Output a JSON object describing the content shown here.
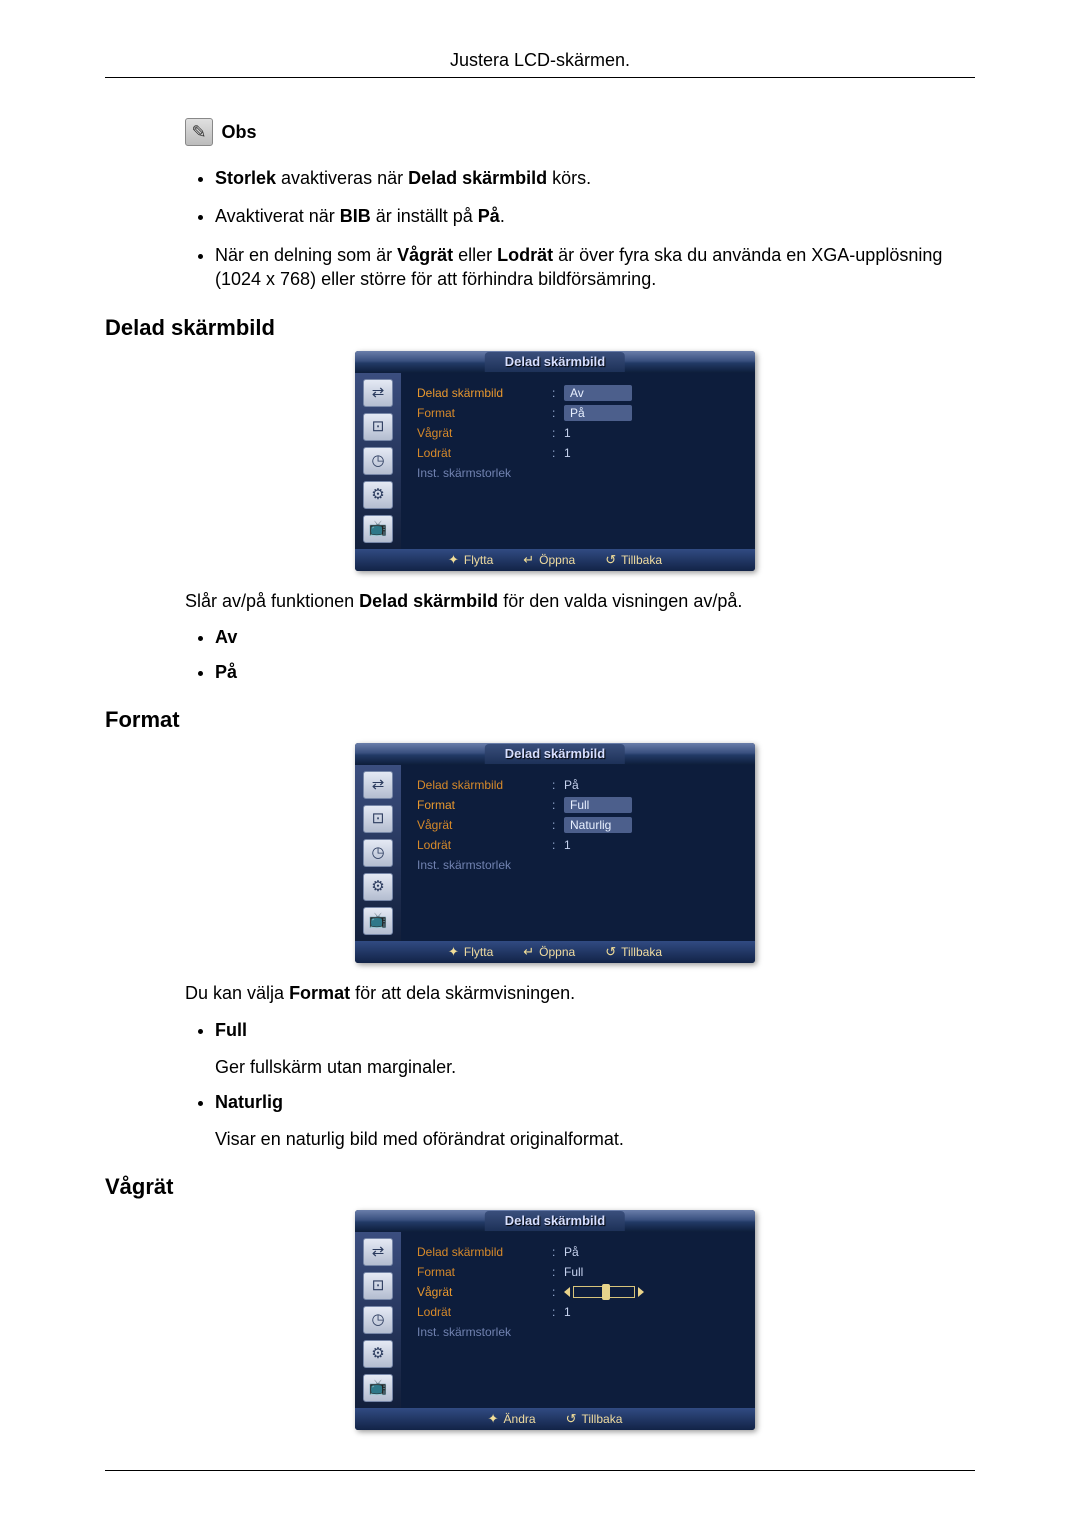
{
  "header": {
    "title": "Justera LCD-skärmen."
  },
  "note": {
    "label": "Obs",
    "items": [
      {
        "parts": {
          "a": "Storlek",
          "b": " avaktiveras när ",
          "c": "Delad skärmbild",
          "d": " körs."
        }
      },
      {
        "parts": {
          "a": "Avaktiverat när ",
          "b": "BIB",
          "c": " är inställt på ",
          "d": "På",
          "e": "."
        }
      },
      {
        "parts": {
          "a": "När en delning som är ",
          "b": "Vågrät",
          "c": " eller ",
          "d": "Lodrät",
          "e": " är över fyra ska du använda en XGA-upplösning (1024 x 768) eller större för att förhindra bildförsämring."
        }
      }
    ]
  },
  "sections": {
    "delad": {
      "heading": "Delad skärmbild",
      "desc": {
        "a": "Slår av/på funktionen ",
        "b": "Delad skärmbild",
        "c": " för den valda visningen av/på."
      },
      "options": [
        {
          "name": "Av"
        },
        {
          "name": "På"
        }
      ]
    },
    "format": {
      "heading": "Format",
      "desc": {
        "a": "Du kan välja ",
        "b": "Format",
        "c": " för att dela skärmvisningen."
      },
      "options": [
        {
          "name": "Full",
          "desc": "Ger fullskärm utan marginaler."
        },
        {
          "name": "Naturlig",
          "desc": "Visar en naturlig bild med oförändrat originalformat."
        }
      ]
    },
    "vagrat": {
      "heading": "Vågrät"
    }
  },
  "osd": {
    "title": "Delad skärmbild",
    "labels": {
      "delad": "Delad skärmbild",
      "format": "Format",
      "vagrat": "Vågrät",
      "lodrat": "Lodrät",
      "inst": "Inst. skärmstorlek"
    },
    "screens": {
      "s1": {
        "delad_val": "Av",
        "format_val": "På",
        "vagrat_val": "1",
        "lodrat_val": "1"
      },
      "s2": {
        "delad_val": "På",
        "format_val": "Full",
        "format_val2": "Naturlig",
        "lodrat_val": "1"
      },
      "s3": {
        "delad_val": "På",
        "format_val": "Full",
        "lodrat_val": "1"
      }
    },
    "footer": {
      "move": "Flytta",
      "open": "Öppna",
      "back": "Tillbaka",
      "change": "Ändra"
    },
    "icons": {
      "i1": "⇄",
      "i2": "⊡",
      "i3": "◷",
      "i4": "⚙",
      "i5": "📺"
    }
  }
}
